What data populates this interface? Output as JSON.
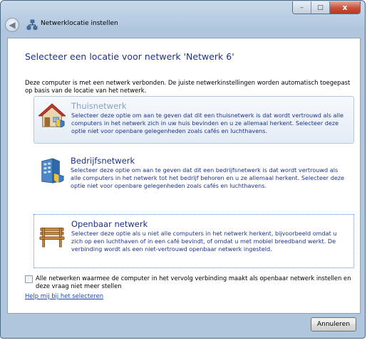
{
  "window": {
    "title": "Netwerklocatie instellen",
    "caption": {
      "minimize": "–",
      "maximize": "□",
      "close": "x"
    }
  },
  "main": {
    "heading": "Selecteer een locatie voor netwerk 'Netwerk  6'",
    "intro": "Deze computer is met een netwerk verbonden. De juiste netwerkinstellingen worden automatisch toegepast op basis van de locatie van het netwerk.",
    "options": [
      {
        "title": "Thuisnetwerk",
        "description": "Selecteer deze optie om aan te geven dat dit een thuisnetwerk is dat wordt vertrouwd als alle computers in het netwerk zich in uw huis bevinden en u ze allemaal herkent. Selecteer deze optie niet voor openbare gelegenheden zoals cafés en luchthavens.",
        "icon": "home-network-icon"
      },
      {
        "title": "Bedrijfsnetwerk",
        "description": "Selecteer deze optie om aan te geven dat dit een bedrijfsnetwerk is dat wordt vertrouwd als alle computers in het netwerk tot het bedrijf behoren en u ze allemaal herkent. Selecteer deze optie niet voor openbare gelegenheden zoals cafés en luchthavens.",
        "icon": "work-network-icon"
      },
      {
        "title": "Openbaar netwerk",
        "description": "Selecteer deze optie als u niet alle computers in het netwerk herkent, bijvoorbeeld omdat u zich op een luchthaven of in een café bevindt, of omdat u met mobiel breedband werkt. De verbinding wordt als een niet-vertrouwd openbaar netwerk ingesteld.",
        "icon": "public-network-icon"
      }
    ],
    "checkbox_label": "Alle netwerken waarmee de computer in het vervolg verbinding maakt als openbaar netwerk instellen en deze vraag niet meer stellen",
    "checkbox_checked": false,
    "help_link": "Help mij bij het selecteren"
  },
  "footer": {
    "cancel_label": "Annuleren"
  }
}
